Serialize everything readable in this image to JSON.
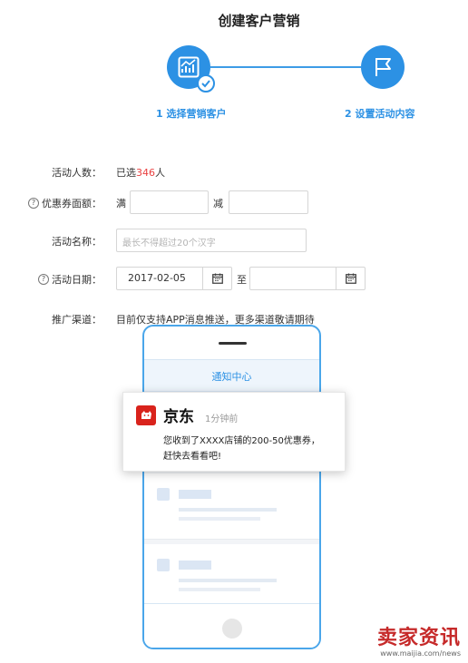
{
  "header": {
    "title": "创建客户营销"
  },
  "steps": [
    {
      "label": "1 选择营销客户",
      "icon": "chart-icon",
      "completed": true
    },
    {
      "label": "2 设置活动内容",
      "icon": "flag-icon",
      "completed": false
    }
  ],
  "colors": {
    "accent": "#2c91e4",
    "highlight": "#e94040",
    "brand": "#d9231c"
  },
  "form": {
    "people": {
      "label": "活动人数：",
      "prefix": "已选",
      "count": "346",
      "suffix": "人"
    },
    "coupon": {
      "label": "优惠券面额：",
      "help_icon": "?",
      "full_word": "满",
      "minus_word": "减",
      "full_value": "",
      "minus_value": ""
    },
    "name": {
      "label": "活动名称：",
      "placeholder": "最长不得超过20个汉字"
    },
    "date": {
      "label": "活动日期：",
      "help_icon": "?",
      "start": "2017-02-05",
      "to_word": "至",
      "end": ""
    },
    "channel": {
      "label": "推广渠道：",
      "text": "目前仅支持APP消息推送，更多渠道敬请期待"
    }
  },
  "phone": {
    "notification_center": "通知中心",
    "notification": {
      "app_name": "京东",
      "time": "1分钟前",
      "message_line1": "您收到了XXXX店铺的200-50优惠券，",
      "message_line2": "赶快去看看吧!"
    }
  },
  "watermark": {
    "logo": "卖家资讯",
    "url": "www.maijia.com/news"
  }
}
